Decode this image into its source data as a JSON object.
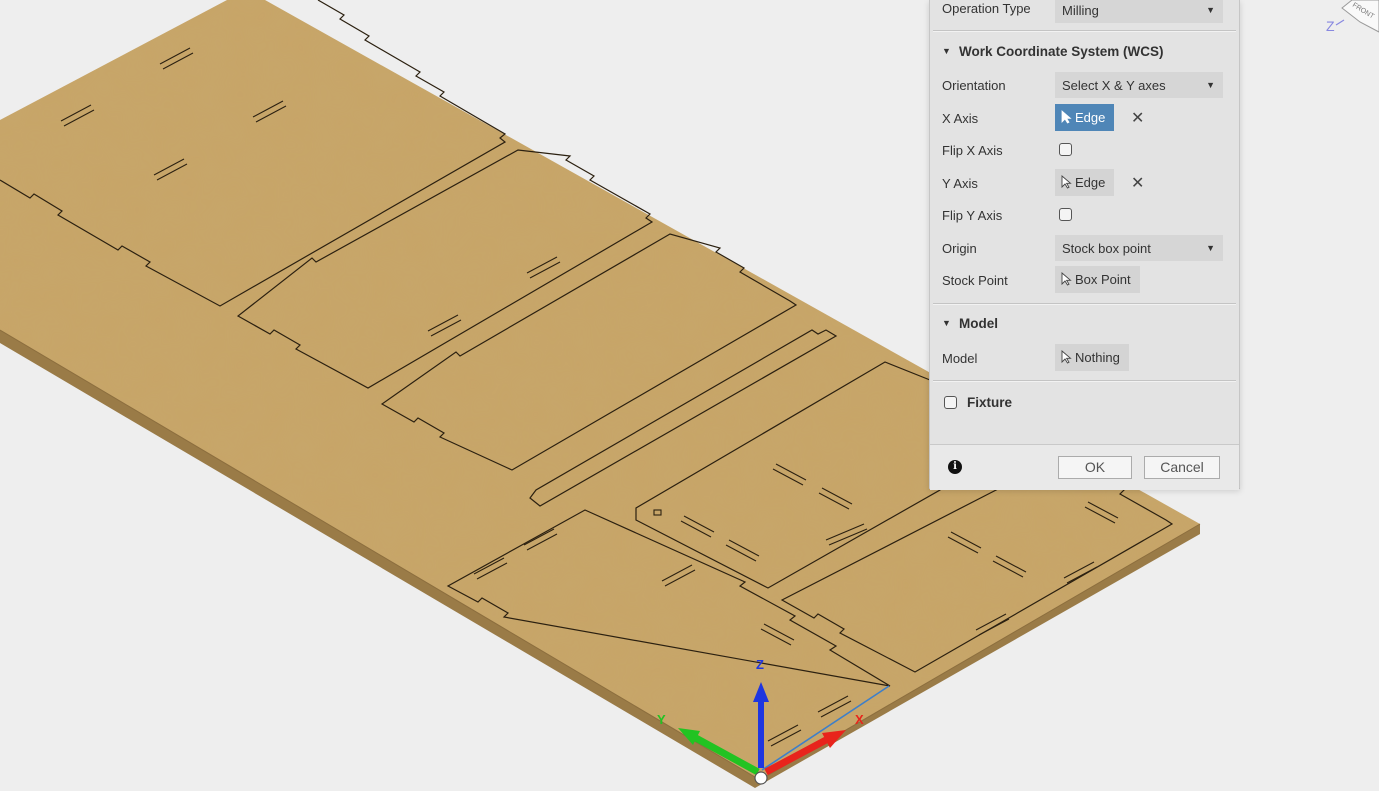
{
  "dialog": {
    "operation_type": {
      "label": "Operation Type",
      "value": "Milling"
    },
    "wcs_section": "Work Coordinate System (WCS)",
    "orientation": {
      "label": "Orientation",
      "value": "Select X & Y axes"
    },
    "x_axis": {
      "label": "X Axis",
      "value": "Edge"
    },
    "flip_x": {
      "label": "Flip X Axis",
      "checked": false
    },
    "y_axis": {
      "label": "Y Axis",
      "value": "Edge"
    },
    "flip_y": {
      "label": "Flip Y Axis",
      "checked": false
    },
    "origin": {
      "label": "Origin",
      "value": "Stock box point"
    },
    "stock_point": {
      "label": "Stock Point",
      "value": "Box Point"
    },
    "model_section": "Model",
    "model": {
      "label": "Model",
      "value": "Nothing"
    },
    "fixture": {
      "label": "Fixture",
      "checked": false
    },
    "ok_label": "OK",
    "cancel_label": "Cancel"
  },
  "triad": {
    "x": "X",
    "y": "Y",
    "z": "Z"
  },
  "viewcube": {
    "axis_label": "Z",
    "face_label": "FRONT"
  },
  "colors": {
    "background": "#eeeeee",
    "board_top": "#c8a567",
    "board_edge": "#9a7b47",
    "active_selection": "#4f86b7",
    "x_axis": "#e8241c",
    "y_axis": "#22c322",
    "z_axis": "#1f36e0"
  }
}
